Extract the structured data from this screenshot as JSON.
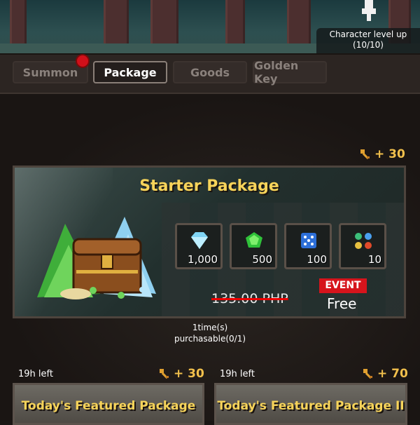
{
  "header": {
    "level_line1": "Character level up",
    "level_line2": "(10/10)"
  },
  "tabs": [
    {
      "label": "Summon",
      "active": false,
      "has_notification": true
    },
    {
      "label": "Package",
      "active": true
    },
    {
      "label": "Goods",
      "active": false
    },
    {
      "label": "Golden Key",
      "active": false
    }
  ],
  "starter": {
    "key_bonus": "+ 30",
    "title": "Starter Package",
    "rewards": [
      {
        "icon": "diamond-icon",
        "amount": "1,000"
      },
      {
        "icon": "green-gem-icon",
        "amount": "500"
      },
      {
        "icon": "dice-icon",
        "amount": "100"
      },
      {
        "icon": "elemental-orbs-icon",
        "amount": "10"
      }
    ],
    "old_price": "135.00 PHP",
    "event_badge": "EVENT",
    "price": "Free",
    "purchase_line1": "1time(s)",
    "purchase_line2": "purchasable(0/1)"
  },
  "featured": [
    {
      "time_left": "19h left",
      "key_bonus": "+ 30",
      "title": "Today's Featured Package"
    },
    {
      "time_left": "19h left",
      "key_bonus": "+ 70",
      "title": "Today's Featured Package II"
    }
  ],
  "colors": {
    "accent_gold": "#f7d45a",
    "event_red": "#d6141c",
    "notification_red": "#d0101a"
  }
}
